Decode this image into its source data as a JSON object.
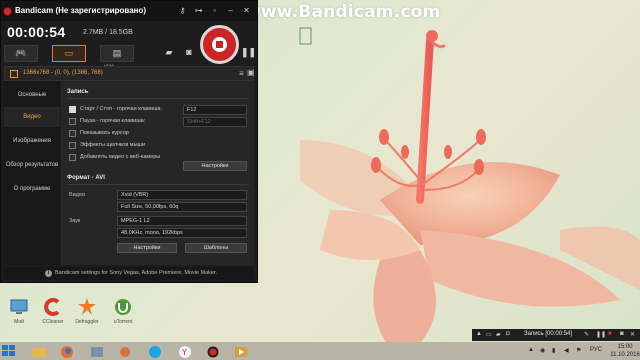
{
  "watermark": "www.Bandicam.com",
  "window": {
    "title": "Bandicam (Не зарегистрировано)",
    "record_time": "00:00:54",
    "file_size": "2.7MB / 18.5GB",
    "mode_hdmi_label": "HDMI",
    "region_text": "1366x768 - (0, 0), (1366, 768)"
  },
  "sidebar": {
    "items": [
      {
        "label": "Основные"
      },
      {
        "label": "Видео"
      },
      {
        "label": "Изображения"
      },
      {
        "label": "Обзор результатов"
      },
      {
        "label": "О программе"
      }
    ],
    "active_index": 1
  },
  "record_section": {
    "title": "Запись",
    "options": [
      {
        "label": "Старт / Стоп - горячая клавиша:",
        "checked": true,
        "hotkey": "F12"
      },
      {
        "label": "Пауза - горячая клавиша:",
        "checked": false,
        "hotkey": "Shift+F12"
      },
      {
        "label": "Показывать курсор",
        "checked": false
      },
      {
        "label": "Эффекты щелчков мыши",
        "checked": false
      },
      {
        "label": "Добавлять видео с веб-камеры",
        "checked": false
      }
    ],
    "settings_button": "Настройки"
  },
  "format_section": {
    "title": "Формат - AVI",
    "video_label": "Видео",
    "video_codec": "Xvid (VBR)",
    "video_details": "Full Size, 50,00fps, 60q",
    "audio_label": "Звук",
    "audio_codec": "MPEG-1 L2",
    "audio_details": "48,0KHz, mono, 192kbps",
    "settings_button": "Настройки",
    "templates_button": "Шаблоны"
  },
  "footer": {
    "text": "Bandicam settings for Sony Vegas, Adobe Premiere, Movie Maker."
  },
  "desktop_icons": [
    {
      "label": "Мой",
      "icon": "computer-icon"
    },
    {
      "label": "CCleaner",
      "icon": "ccleaner-icon"
    },
    {
      "label": "Defraggler",
      "icon": "defraggler-icon"
    },
    {
      "label": "uTorrent",
      "icon": "utorrent-icon"
    }
  ],
  "tray_bar": {
    "text": "Запись [00:00:54]"
  },
  "taskbar": {
    "language": "РУС",
    "time": "15:00",
    "date": "11.10.2016"
  },
  "colors": {
    "accent": "#f0a64a",
    "record_red": "#cc2424",
    "window_bg": "#1d1d1d"
  }
}
